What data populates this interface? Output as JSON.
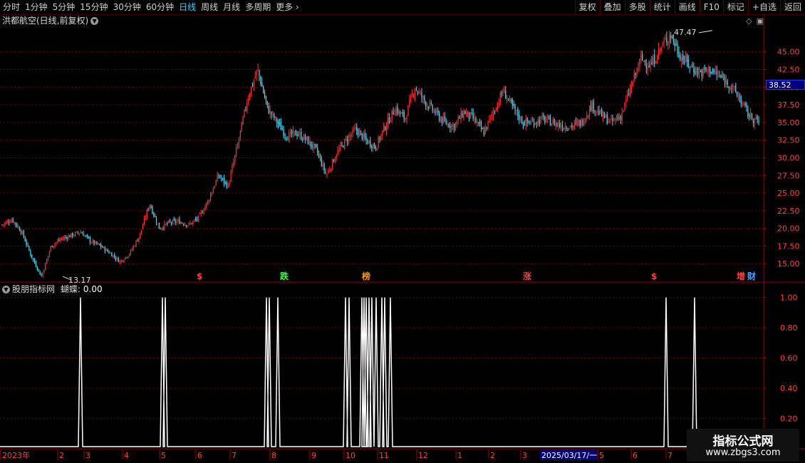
{
  "topbar": {
    "tabs": [
      "分时",
      "1分钟",
      "5分钟",
      "15分钟",
      "30分钟",
      "60分钟",
      "日线",
      "周线",
      "月线",
      "多周期",
      "更多"
    ],
    "active_tab": "日线",
    "more_arrow": "›",
    "right_buttons": [
      "复权",
      "叠加",
      "多股",
      "统计",
      "画线",
      "F10",
      "标记",
      "+自选",
      "返回"
    ]
  },
  "stock": {
    "title": "洪都航空(日线,前复权)",
    "current_price": "38.52",
    "high_label": "47.47",
    "low_label": "13.17"
  },
  "indicator": {
    "title": "股朋指标网",
    "name": "蝴蝶:",
    "value": "0.00"
  },
  "price_axis": [
    "45.00",
    "42.50",
    "40.00",
    "37.50",
    "35.00",
    "32.50",
    "30.00",
    "27.50",
    "25.00",
    "22.50",
    "20.00",
    "17.50",
    "15.00"
  ],
  "ind_axis": [
    "1.00",
    "0.80",
    "0.60",
    "0.40",
    "0.20"
  ],
  "markers": [
    {
      "text": "$",
      "color": "#ff4040",
      "x": 276
    },
    {
      "text": "跌",
      "color": "#40ff40",
      "x": 393
    },
    {
      "text": "榜",
      "color": "#ff9900",
      "x": 508
    },
    {
      "text": "涨",
      "color": "#ff4040",
      "x": 734
    },
    {
      "text": "$",
      "color": "#ff4040",
      "x": 914
    },
    {
      "text": "增",
      "color": "#ff4040",
      "x": 1034
    },
    {
      "text": "财",
      "color": "#4fa0ff",
      "x": 1049
    }
  ],
  "time_axis": {
    "labels": [
      {
        "t": "2023年",
        "x": 3
      },
      {
        "t": "2",
        "x": 83
      },
      {
        "t": "3",
        "x": 120
      },
      {
        "t": "4",
        "x": 174
      },
      {
        "t": "5",
        "x": 226
      },
      {
        "t": "6",
        "x": 277
      },
      {
        "t": "7",
        "x": 325
      },
      {
        "t": "8",
        "x": 381
      },
      {
        "t": "9",
        "x": 437
      },
      {
        "t": "10",
        "x": 485
      },
      {
        "t": "11",
        "x": 532
      },
      {
        "t": "12",
        "x": 587
      },
      {
        "t": "1",
        "x": 642
      },
      {
        "t": "2",
        "x": 688
      },
      {
        "t": "3",
        "x": 733
      },
      {
        "t": "5",
        "x": 841
      },
      {
        "t": "6",
        "x": 888
      },
      {
        "t": "7",
        "x": 937
      }
    ],
    "date_box": "2025/03/17/一"
  },
  "watermark": {
    "line1": "指标公式网",
    "line2": "www.zbgs3.com"
  },
  "colors": {
    "up": "#ff3030",
    "down": "#40e0ff",
    "grid": "#7a0000",
    "axis_text": "#ff4040",
    "ind_line": "#ffffff"
  },
  "chart_data": [
    {
      "type": "candlestick",
      "title": "洪都航空(日线,前复权)",
      "ylim": [
        12.5,
        48.5
      ],
      "x": [
        "2023-01",
        "2023-02",
        "2023-03",
        "2023-04",
        "2023-05",
        "2023-06",
        "2023-07",
        "2023-08",
        "2023-09",
        "2023-10",
        "2023-11",
        "2023-12",
        "2024-01",
        "2024-02",
        "2024-03",
        "2024-05",
        "2024-06",
        "2024-07",
        "2025-03-17"
      ],
      "series": [
        {
          "values": [
            20.5,
            21.3,
            19.5,
            16.0,
            13.2,
            17.5,
            18.5,
            19.0,
            19.5,
            18.2,
            17.5,
            16.5,
            15.3,
            16.5,
            19.0,
            23.5,
            20.0,
            20.8,
            21.0,
            20.5,
            21.5,
            24.0,
            27.5,
            26.0,
            32.0,
            38.5,
            42.5,
            37.0,
            35.0,
            33.0,
            33.5,
            32.5,
            31.0,
            27.5,
            30.5,
            32.5,
            34.0,
            32.5,
            31.5,
            34.5,
            37.0,
            35.5,
            40.0,
            38.0,
            36.5,
            35.0,
            34.5,
            36.5,
            35.5,
            33.5,
            36.5,
            39.5,
            37.0,
            35.0,
            35.0,
            35.5,
            35.0,
            34.5,
            34.5,
            35.0,
            37.5,
            36.0,
            35.0,
            36.0,
            40.0,
            44.0,
            43.0,
            45.5,
            47.5,
            44.5,
            43.0,
            42.0,
            42.5,
            41.5,
            40.5,
            38.5,
            36.0,
            35.0
          ]
        }
      ]
    },
    {
      "type": "line",
      "title": "股朋指标网",
      "ylim": [
        0,
        1.05
      ],
      "series": [
        {
          "name": "蝴蝶",
          "values": [
            0,
            0,
            1,
            0,
            0,
            1,
            1,
            0,
            0,
            0,
            1,
            1,
            0,
            1,
            0,
            0,
            0,
            1,
            1,
            0,
            1,
            1,
            0,
            1,
            0,
            1,
            0,
            1,
            0,
            0,
            0,
            0,
            1,
            0,
            1,
            0
          ]
        }
      ]
    }
  ]
}
